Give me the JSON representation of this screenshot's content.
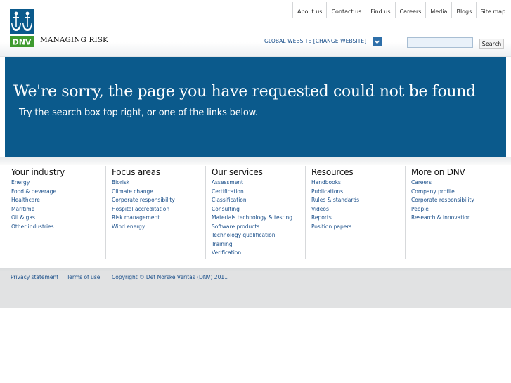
{
  "top_nav": [
    "About us",
    "Contact us",
    "Find us",
    "Careers",
    "Media",
    "Blogs",
    "Site map"
  ],
  "brand": {
    "logo_text": "DNV",
    "tagline": "MANAGING RISK",
    "color": "#0b5a8c",
    "logo_green": "#3f9b2f"
  },
  "global_site": {
    "label": "GLOBAL WEBSITE [CHANGE WEBSITE]",
    "icon": "chevron-down-icon"
  },
  "search": {
    "value": "",
    "button_label": "Search"
  },
  "banner": {
    "heading": "We're sorry, the page you have requested could not be found",
    "subheading": "Try the search box top right, or one of the links below."
  },
  "columns": [
    {
      "title": "Your industry",
      "links": [
        "Energy",
        "Food & beverage",
        "Healthcare",
        "Maritime",
        "Oil & gas",
        "Other industries"
      ]
    },
    {
      "title": "Focus areas",
      "links": [
        "Biorisk",
        "Climate change",
        "Corporate responsibility",
        "Hospital accreditation",
        "Risk management",
        "Wind energy"
      ]
    },
    {
      "title": "Our services",
      "links": [
        "Assessment",
        "Certification",
        "Classification",
        "Consulting",
        "Materials technology & testing",
        "Software products",
        "Technology qualification",
        "Training",
        "Verification"
      ]
    },
    {
      "title": "Resources",
      "links": [
        "Handbooks",
        "Publications",
        "Rules & standards",
        "Videos",
        "Reports",
        "Position papers"
      ]
    },
    {
      "title": "More on DNV",
      "links": [
        "Careers",
        "Company profile",
        "Corporate responsibility",
        "People",
        "Research & innovation"
      ]
    }
  ],
  "footer": {
    "privacy": "Privacy statement",
    "terms": "Terms of use",
    "copyright": "Copyright © Det Norske Veritas (DNV) 2011"
  }
}
